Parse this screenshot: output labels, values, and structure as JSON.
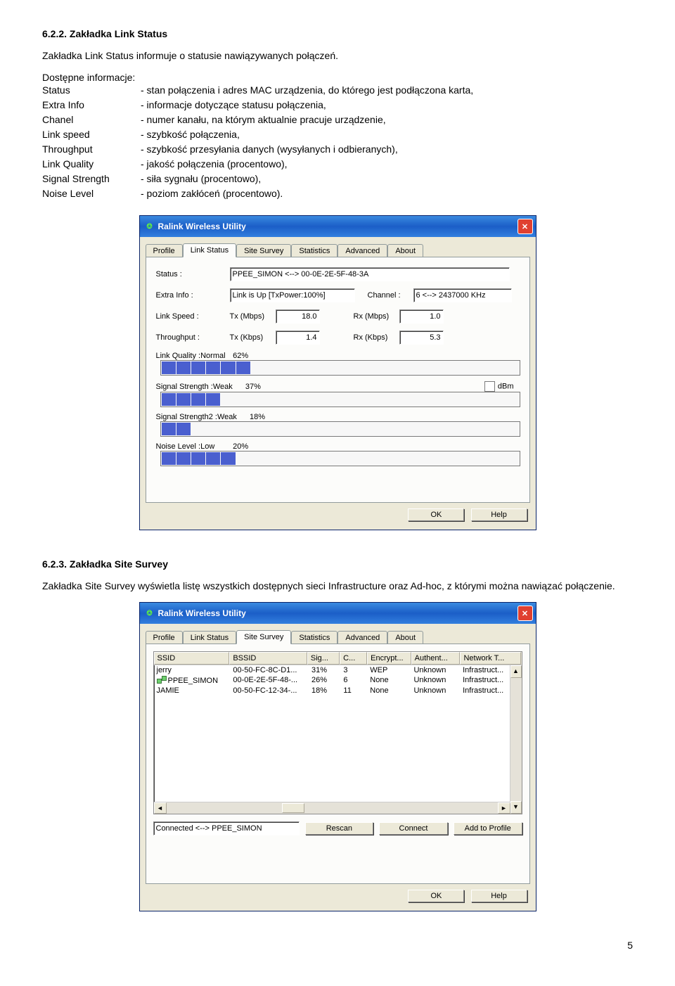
{
  "section1": {
    "title": "6.2.2. Zakładka Link Status",
    "intro": "Zakładka Link Status informuje o statusie nawiązywanych połączeń.",
    "defs_header": "Dostępne informacje:",
    "defs": [
      {
        "term": "Status",
        "desc": "- stan połączenia i adres MAC urządzenia, do którego jest podłączona karta,"
      },
      {
        "term": "Extra Info",
        "desc": "- informacje dotyczące statusu połączenia,"
      },
      {
        "term": "Chanel",
        "desc": "- numer kanału, na którym aktualnie pracuje urządzenie,"
      },
      {
        "term": "Link speed",
        "desc": "- szybkość połączenia,"
      },
      {
        "term": "Throughput",
        "desc": "- szybkość przesyłania danych (wysyłanych i odbieranych),"
      },
      {
        "term": "Link Quality",
        "desc": "- jakość połączenia (procentowo),"
      },
      {
        "term": "Signal Strength",
        "desc": "- siła sygnału (procentowo),"
      },
      {
        "term": "Noise Level",
        "desc": "- poziom zakłóceń (procentowo)."
      }
    ]
  },
  "dlg1": {
    "title": "Ralink Wireless Utility",
    "tabs": [
      "Profile",
      "Link Status",
      "Site Survey",
      "Statistics",
      "Advanced",
      "About"
    ],
    "active_tab": 1,
    "labels": {
      "status": "Status :",
      "extra": "Extra Info :",
      "channel": "Channel :",
      "linkspeed": "Link Speed :",
      "throughput": "Throughput :",
      "tx_mbps": "Tx (Mbps)",
      "rx_mbps": "Rx (Mbps)",
      "tx_kbps": "Tx (Kbps)",
      "rx_kbps": "Rx (Kbps)",
      "link_quality": "Link Quality :",
      "signal1": "Signal Strength :",
      "signal2": "Signal Strength2 :",
      "noise": "Noise Level :",
      "dbm": "dBm",
      "normal": "Normal",
      "weak": "Weak",
      "low": "Low"
    },
    "values": {
      "status": "PPEE_SIMON <--> 00-0E-2E-5F-48-3A",
      "extra": "Link is Up [TxPower:100%]",
      "channel": "6 <--> 2437000 KHz",
      "tx_mbps": "18.0",
      "rx_mbps": "1.0",
      "tx_kbps": "1.4",
      "rx_kbps": "5.3",
      "lq_pct": "62%",
      "s1_pct": "37%",
      "s2_pct": "18%",
      "noise_pct": "20%"
    },
    "bars": {
      "lq": 6,
      "s1": 4,
      "s2": 2,
      "noise": 5
    },
    "buttons": {
      "ok": "OK",
      "help": "Help"
    }
  },
  "section2": {
    "title": "6.2.3. Zakładka Site Survey",
    "intro": "Zakładka Site Survey wyświetla listę wszystkich dostępnych sieci Infrastructure oraz Ad-hoc, z którymi można nawiązać połączenie."
  },
  "dlg2": {
    "title": "Ralink Wireless Utility",
    "tabs": [
      "Profile",
      "Link Status",
      "Site Survey",
      "Statistics",
      "Advanced",
      "About"
    ],
    "active_tab": 2,
    "cols": [
      "SSID",
      "BSSID",
      "Sig...",
      "C...",
      "Encrypt...",
      "Authent...",
      "Network T..."
    ],
    "rows": [
      {
        "ssid": "jerry",
        "bssid": "00-50-FC-8C-D1...",
        "sig": "31%",
        "ch": "3",
        "enc": "WEP",
        "auth": "Unknown",
        "net": "Infrastruct...",
        "connected": false
      },
      {
        "ssid": "PPEE_SIMON",
        "bssid": "00-0E-2E-5F-48-...",
        "sig": "26%",
        "ch": "6",
        "enc": "None",
        "auth": "Unknown",
        "net": "Infrastruct...",
        "connected": true
      },
      {
        "ssid": "JAMIE",
        "bssid": "00-50-FC-12-34-...",
        "sig": "18%",
        "ch": "11",
        "enc": "None",
        "auth": "Unknown",
        "net": "Infrastruct...",
        "connected": false
      }
    ],
    "status": "Connected <--> PPEE_SIMON",
    "buttons": {
      "rescan": "Rescan",
      "connect": "Connect",
      "add": "Add to Profile",
      "ok": "OK",
      "help": "Help"
    }
  },
  "pagenum": "5"
}
